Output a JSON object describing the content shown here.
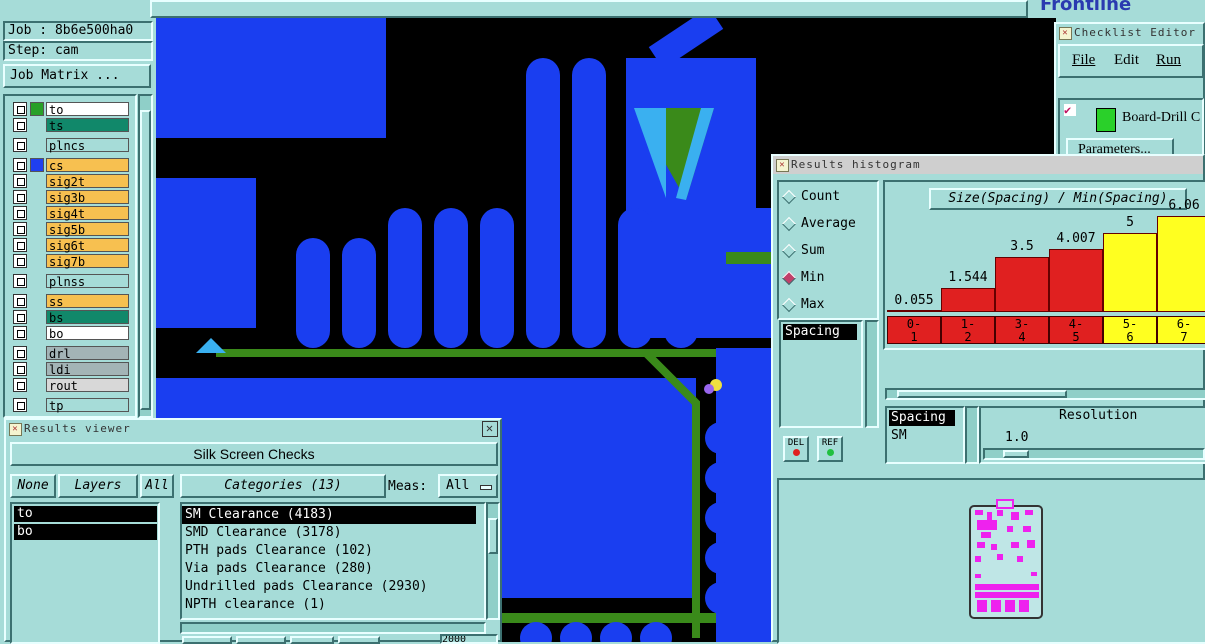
{
  "top_bar": {
    "logo_partial": "Frontline"
  },
  "job_panel": {
    "job_label": "Job : 8b6e500ha0",
    "step_label": "Step: cam",
    "matrix_button": "Job Matrix ..."
  },
  "layers": [
    {
      "name": "to",
      "color": "#ffffff",
      "swatch": "#28a028"
    },
    {
      "name": "ts",
      "color": "#11886a",
      "swatch": ""
    },
    {
      "name": "plncs",
      "color": "#a6dcd8",
      "swatch": ""
    },
    {
      "name": "cs",
      "color": "#f7c050",
      "swatch": "#1f3ff0"
    },
    {
      "name": "sig2t",
      "color": "#f7c050",
      "swatch": ""
    },
    {
      "name": "sig3b",
      "color": "#f7c050",
      "swatch": ""
    },
    {
      "name": "sig4t",
      "color": "#f7c050",
      "swatch": ""
    },
    {
      "name": "sig5b",
      "color": "#f7c050",
      "swatch": ""
    },
    {
      "name": "sig6t",
      "color": "#f7c050",
      "swatch": ""
    },
    {
      "name": "sig7b",
      "color": "#f7c050",
      "swatch": ""
    },
    {
      "name": "plnss",
      "color": "#a6dcd8",
      "swatch": ""
    },
    {
      "name": "ss",
      "color": "#f7c050",
      "swatch": ""
    },
    {
      "name": "bs",
      "color": "#11886a",
      "swatch": ""
    },
    {
      "name": "bo",
      "color": "#ffffff",
      "swatch": ""
    },
    {
      "name": "drl",
      "color": "#a3b4b6",
      "swatch": ""
    },
    {
      "name": "ldi",
      "color": "#a3b4b6",
      "swatch": ""
    },
    {
      "name": "rout",
      "color": "#d8d8d8",
      "swatch": ""
    },
    {
      "name": "tp",
      "color": "#a6dcd8",
      "swatch": ""
    }
  ],
  "results_viewer": {
    "title": "Results viewer",
    "header": "Silk Screen Checks",
    "none_btn": "None",
    "layers_btn": "Layers",
    "all_btn": "All",
    "categories_btn": "Categories (13)",
    "meas_label": "Meas:",
    "meas_value": "All",
    "layer_list": [
      "to",
      "bo"
    ],
    "categories": [
      "SM Clearance (4183)",
      "SMD Clearance (3178)",
      "PTH pads Clearance (102)",
      "Via pads Clearance (280)",
      "Undrilled pads Clearance (2930)",
      "NPTH clearance (1)"
    ],
    "bottom_field": "2000"
  },
  "checklist_editor": {
    "title": "Checklist Editor",
    "menu": [
      "File",
      "Edit",
      "Run"
    ],
    "item": "Board-Drill C",
    "params_btn": "Parameters..."
  },
  "histogram": {
    "title": "Results histogram",
    "modes": [
      "Count",
      "Average",
      "Sum",
      "Min",
      "Max"
    ],
    "selected_mode": "Min",
    "chart_title": "Size(Spacing) / Min(Spacing)",
    "attr_list": [
      "Spacing"
    ],
    "del_btn": "DEL",
    "ref_btn": "REF",
    "bins_list": [
      "Spacing",
      "SM"
    ],
    "resolution_label": "Resolution",
    "resolution_value": "1.0"
  },
  "chart_data": {
    "type": "bar",
    "categories": [
      "0-1",
      "1-2",
      "3-4",
      "4-5",
      "5-6",
      "6-7"
    ],
    "values": [
      0.055,
      1.544,
      3.5,
      4.007,
      5,
      6.06
    ],
    "value_labels": [
      "0.055",
      "1.544",
      "3.5",
      "4.007",
      "5",
      "6.06"
    ],
    "colors": [
      "#e02020",
      "#e02020",
      "#e02020",
      "#e02020",
      "#ffff20",
      "#ffff20"
    ],
    "title": "Size(Spacing) / Min(Spacing)"
  }
}
